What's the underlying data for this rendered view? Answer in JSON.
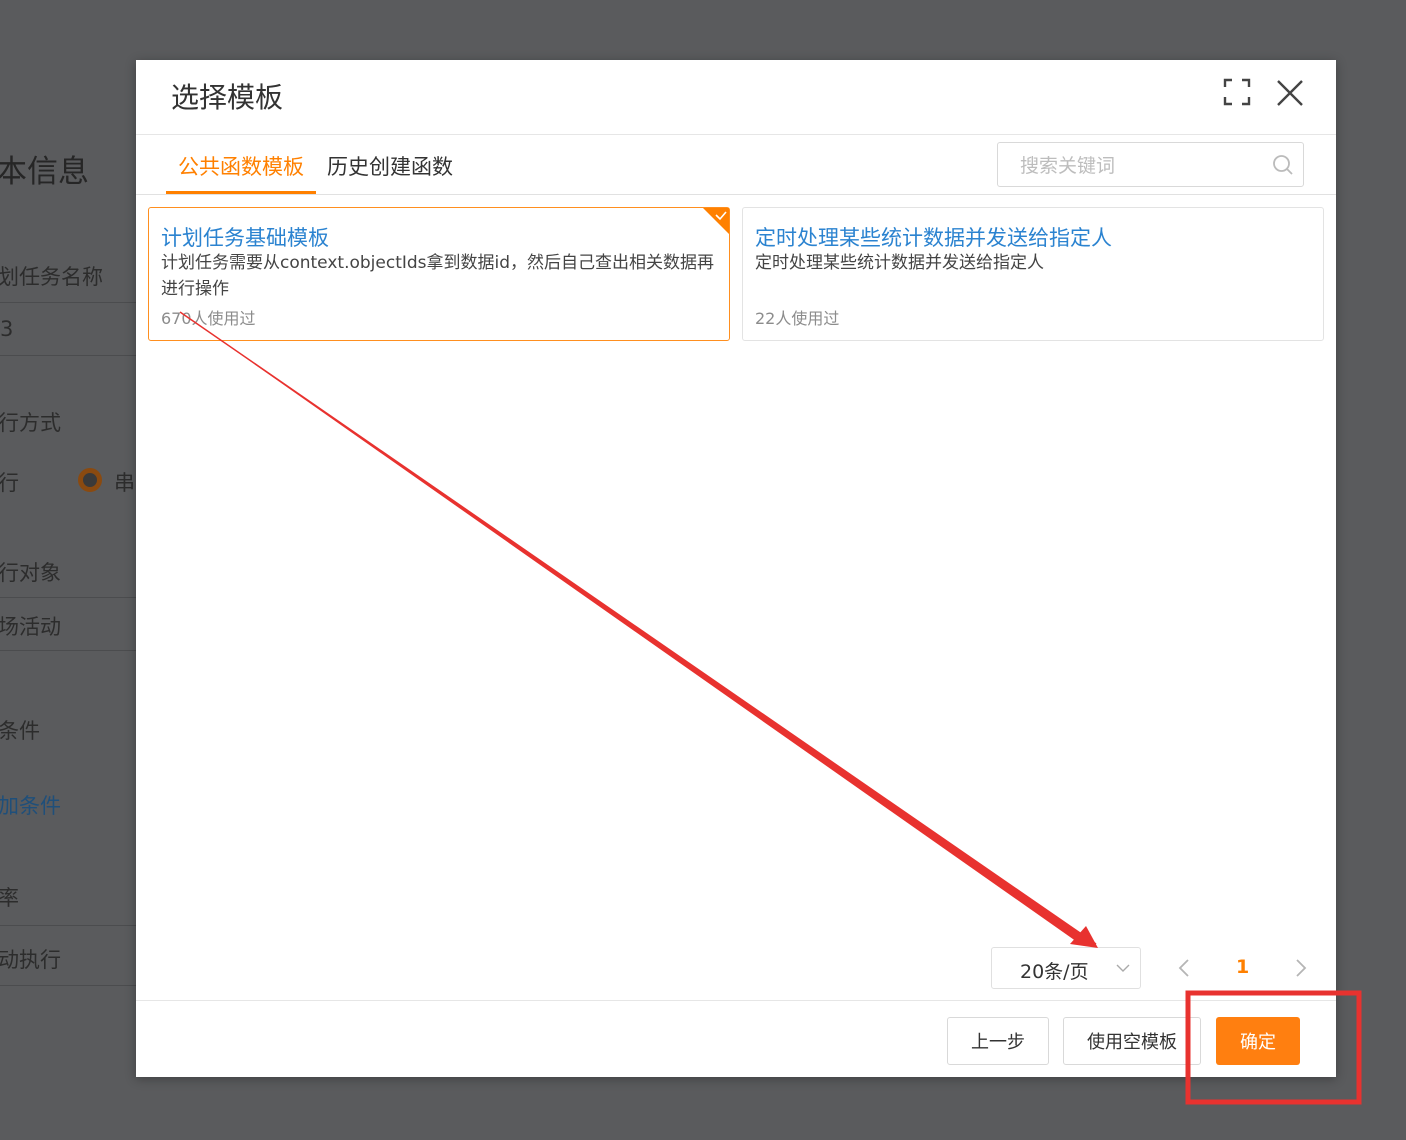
{
  "background": {
    "section_title": "本信息",
    "task_name_label": "划任务名称",
    "task_name_value": "3",
    "exec_mode_label": "行方式",
    "parallel_label": "行",
    "serial_label": "串",
    "exec_object_label": "行对象",
    "exec_object_value": "场活动",
    "condition_label": "条件",
    "add_condition_link": "加条件",
    "frequency_label": "率",
    "frequency_value": "动执行"
  },
  "modal": {
    "title": "选择模板",
    "tabs": [
      {
        "label": "公共函数模板",
        "active": true
      },
      {
        "label": "历史创建函数",
        "active": false
      }
    ],
    "search": {
      "placeholder": "搜索关键词",
      "value": ""
    },
    "templates": [
      {
        "title": "计划任务基础模板",
        "description": "计划任务需要从context.objectIds拿到数据id，然后自己查出相关数据再进行操作",
        "usage": "670人使用过",
        "selected": true
      },
      {
        "title": "定时处理某些统计数据并发送给指定人",
        "description": "定时处理某些统计数据并发送给指定人",
        "usage": "22人使用过",
        "selected": false
      }
    ],
    "pagination": {
      "page_size": "20条/页",
      "current_page": "1"
    },
    "footer": {
      "prev_label": "上一步",
      "empty_template_label": "使用空模板",
      "confirm_label": "确定"
    }
  },
  "colors": {
    "accent": "#ff8000",
    "link": "#2b83d0",
    "annotation": "#e8322f"
  }
}
